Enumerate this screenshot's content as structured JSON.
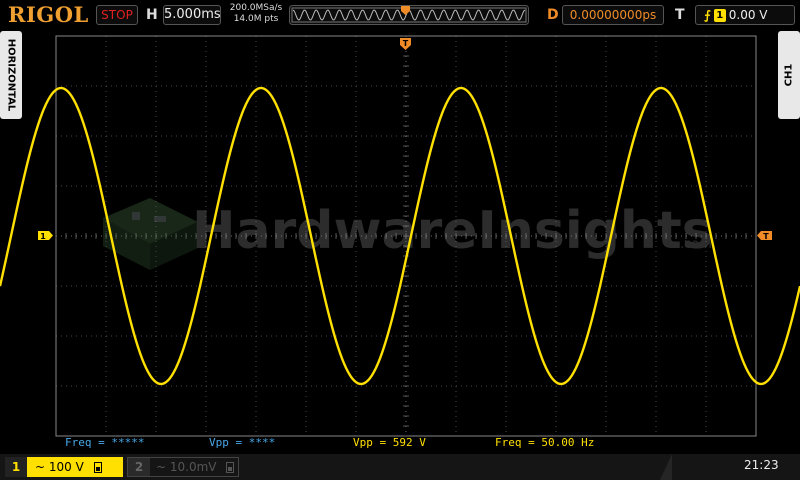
{
  "brand": "RIGOL",
  "acquisition": {
    "status": "STOP"
  },
  "horizontal": {
    "label": "H",
    "timebase": "5.000ms",
    "sample_rate": "200.0MSa/s",
    "memory_depth": "14.0M pts"
  },
  "trigger_marker": "T",
  "delay": {
    "label": "D",
    "value": "0.00000000ps"
  },
  "trigger": {
    "label": "T",
    "edge_icon": "rising-edge-icon",
    "source": "1",
    "level": "0.00 V"
  },
  "side_tabs": {
    "left": "HORIZONTAL",
    "right": "CH1"
  },
  "markers": {
    "channel1_ground": "1",
    "trigger_level": "T"
  },
  "watermark": {
    "text": "HardwareInsights",
    "suffix": ".com"
  },
  "measurements": [
    {
      "label": "Freq = *****",
      "color": "#48a8e8"
    },
    {
      "label": "Vpp = ****",
      "color": "#48a8e8"
    },
    {
      "label": "Vpp = 592 V",
      "color": "#ffe000"
    },
    {
      "label": "Freq = 50.00 Hz",
      "color": "#ffe000"
    }
  ],
  "channels": [
    {
      "number": "1",
      "coupling": "~",
      "scale": "100 V",
      "active": true,
      "color": "#ffe000"
    },
    {
      "number": "2",
      "coupling": "~",
      "scale": "10.0mV",
      "active": false,
      "color": "#666666"
    }
  ],
  "clock": "21:23",
  "colors": {
    "ch1": "#ffe000",
    "accent": "#f08c28",
    "grid": "#555555",
    "stop": "#e02020"
  },
  "waveform": {
    "type": "sine",
    "frequency_hz": 50,
    "vpp": 592,
    "timebase_per_div_ms": 5,
    "volts_per_div": 100,
    "cycles_visible": 3.5
  }
}
